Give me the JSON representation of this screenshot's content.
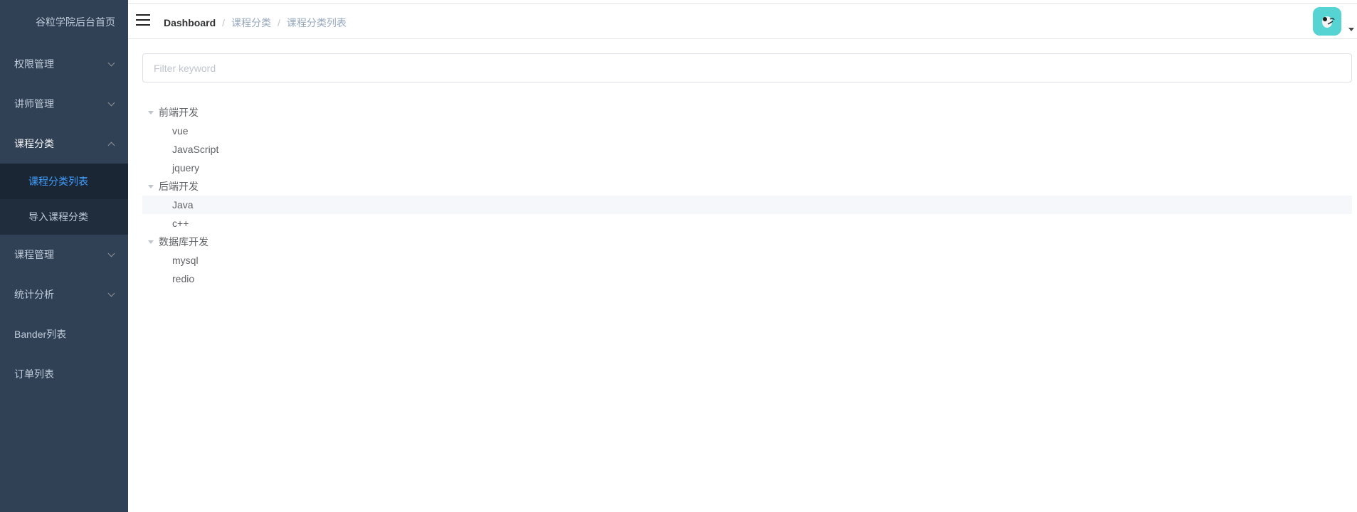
{
  "sidebar": {
    "logo": "谷粒学院后台首页",
    "menu": [
      {
        "label": "权限管理",
        "has_children": true,
        "open": false
      },
      {
        "label": "讲师管理",
        "has_children": true,
        "open": false
      },
      {
        "label": "课程分类",
        "has_children": true,
        "open": true,
        "children": [
          {
            "label": "课程分类列表",
            "active": true
          },
          {
            "label": "导入课程分类",
            "active": false
          }
        ]
      },
      {
        "label": "课程管理",
        "has_children": true,
        "open": false
      },
      {
        "label": "统计分析",
        "has_children": true,
        "open": false
      },
      {
        "label": "Bander列表",
        "has_children": false
      },
      {
        "label": "订单列表",
        "has_children": false
      }
    ]
  },
  "navbar": {
    "breadcrumb": [
      "Dashboard",
      "课程分类",
      "课程分类列表"
    ],
    "separator": "/"
  },
  "filter": {
    "placeholder": "Filter keyword",
    "value": ""
  },
  "tree": [
    {
      "label": "前端开发",
      "children": [
        "vue",
        "JavaScript",
        "jquery"
      ]
    },
    {
      "label": "后端开发",
      "children": [
        "Java",
        "c++"
      ]
    },
    {
      "label": "数据库开发",
      "children": [
        "mysql",
        "redio"
      ]
    }
  ],
  "colors": {
    "sidebar_bg": "#304156",
    "submenu_bg": "#1f2d3d",
    "active_text": "#409eff",
    "avatar_bg": "#56d4d3"
  }
}
